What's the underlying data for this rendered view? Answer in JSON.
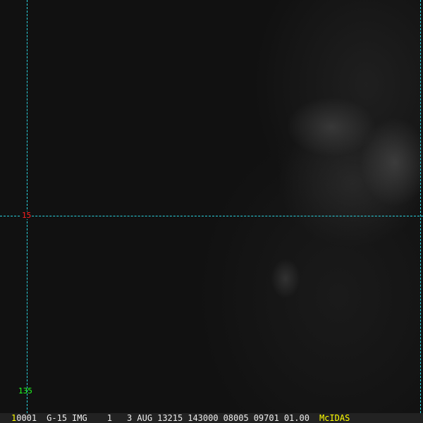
{
  "grid": {
    "lat_label": "15",
    "lon_label": "135",
    "line_color": "#2ad4e0",
    "lat_label_color": "#ff2020",
    "lon_label_color": "#20ff20"
  },
  "status": {
    "frame_num": "1",
    "fields": [
      "0001",
      "G-15",
      "IMG",
      "1",
      "3 AUG",
      "13215",
      "143000",
      "08005",
      "09701",
      "01.00"
    ],
    "brand": "McIDAS",
    "brand_color": "#ffff00"
  }
}
